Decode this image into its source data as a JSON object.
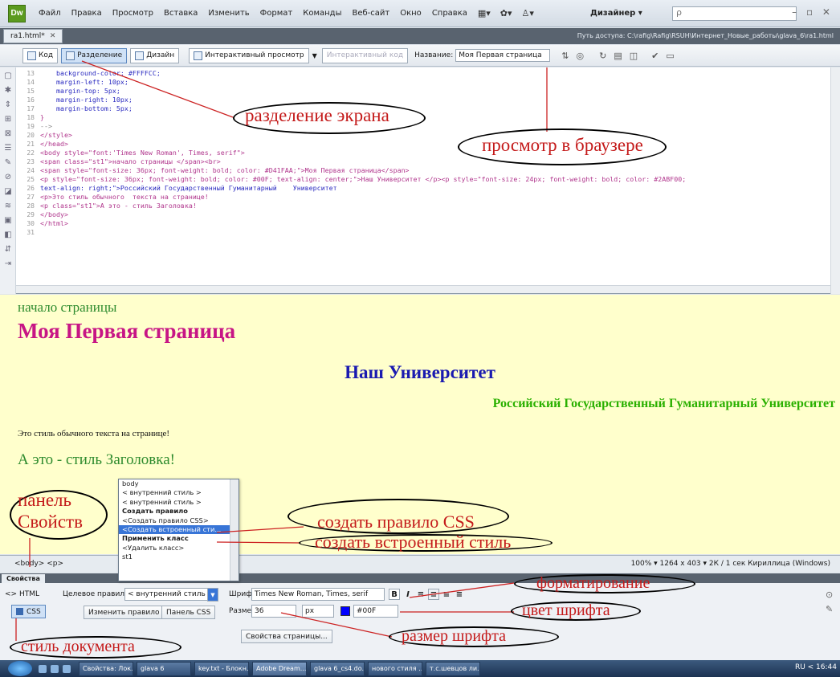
{
  "app": {
    "logo": "Dw",
    "designer_label": "Дизайнер ▾",
    "search_glyph": "ρ",
    "window_controls": "– ▫ ✕"
  },
  "menu": [
    "Файл",
    "Правка",
    "Просмотр",
    "Вставка",
    "Изменить",
    "Формат",
    "Команды",
    "Веб-сайт",
    "Окно",
    "Справка"
  ],
  "doc_tab": {
    "name": "ra1.html*",
    "close": "✕"
  },
  "doc_path": "Путь доступа: C:\\rafig\\Rafig\\RSUH\\Интернет_Новые_работы\\glava_6\\ra1.html",
  "toolbar": {
    "code": "Код",
    "split": "Разделение",
    "design": "Дизайн",
    "live_view": "Интерактивный просмотр",
    "live_code": "Интерактивный код",
    "title_label": "Название:",
    "title_value": "Моя Первая страница"
  },
  "code": {
    "line_numbers": [
      "13",
      "14",
      "15",
      "16",
      "17",
      "18",
      "19",
      "20",
      "21",
      "22",
      "23",
      "24",
      "25",
      "26",
      "",
      "27",
      "28",
      "29",
      "30",
      "31"
    ],
    "lines": [
      "    background-color: #FFFFCC;",
      "    margin-left: 10px;",
      "    margin-top: 5px;",
      "    margin-right: 10px;",
      "    margin-bottom: 5px;",
      "}",
      "-->",
      "</style>",
      "</head>",
      "",
      "<body style=\"font:'Times New Roman', Times, serif\">",
      "<span class=\"st1\">начало страницы </span><br>",
      "<span style=\"font-size: 36px; font-weight: bold; color: #D41FAA;\">Моя Первая страница</span>",
      "<p style=\"font-size: 36px; font-weight: bold; color: #00F; text-align: center;\">Наш Университет </p><p style=\"font-size: 24px; font-weight: bold; color: #2ABF00;",
      "text-align: right;\">Российский Государственный Гуманитарный    Университет",
      "<p>Это стиль обычного  текста на странице!",
      "<p class=\"st1\">А это - стиль Заголовка!",
      "</body>",
      "</html>",
      ""
    ]
  },
  "design": {
    "line1": "начало страницы",
    "line2": "Моя Первая страница",
    "line3": "Наш Университет",
    "line4": "Российский Государственный Гуманитарный Университет",
    "line5": "Это стиль обычного текста на странице!",
    "line6": "А это - стиль Заголовка!"
  },
  "popup": {
    "items": [
      {
        "label": "body",
        "kind": "item"
      },
      {
        "label": "< внутренний стиль >",
        "kind": "item"
      },
      {
        "label": "< внутренний стиль >",
        "kind": "item"
      },
      {
        "label": "Создать правило",
        "kind": "head"
      },
      {
        "label": "<Создать правило CSS>",
        "kind": "item"
      },
      {
        "label": "<Создать встроенный сти...",
        "kind": "sel"
      },
      {
        "label": "Применить класс",
        "kind": "head"
      },
      {
        "label": "<Удалить класс>",
        "kind": "item"
      },
      {
        "label": "st1",
        "kind": "item"
      }
    ]
  },
  "status": {
    "tag_selector": "<body> <p>",
    "info": "100%  ▾ 1264 x 403 ▾  2К / 1 сек  Кириллица (Windows)"
  },
  "props": {
    "tab": "Свойства",
    "html_btn": "<> HTML",
    "css_btn": "CSS",
    "target_rule_label": "Целевое правило",
    "target_rule_value": "< внутренний стиль >",
    "edit_rule": "Изменить правило",
    "css_panel": "Панель CSS",
    "font_label": "Шрифт",
    "font_value": "Times New Roman, Times, serif",
    "size_label": "Размер",
    "size_value": "36",
    "unit_value": "px",
    "color_value": "#00F",
    "page_props": "Свойства страницы...",
    "bold": "B",
    "italic": "I"
  },
  "taskbar": {
    "items": [
      "Свойства: Лок...",
      "glava 6",
      "key.txt - Блокн...",
      "Adobe Dream...",
      "glava 6_cs4.do...",
      "нового стиля ...",
      "т.с.шевцов ли..."
    ],
    "tray": "RU  <  16:44"
  },
  "annotations": {
    "split": "разделение экрана",
    "browser": "просмотр в браузере",
    "panel": "панель Свойств",
    "create_css": "создать правило CSS",
    "create_inline": "создать встроенный стиль",
    "formatting": "форматирование",
    "font_color": "цвет шрифта",
    "font_size": "размер шрифта",
    "doc_style": "стиль документа"
  },
  "colors": {
    "design_bg": "#ffffcc",
    "annotation": "#c41a1a",
    "heading_pink": "#D41FAA",
    "heading_blue": "#0000FF",
    "heading_green": "#2ABF00"
  }
}
